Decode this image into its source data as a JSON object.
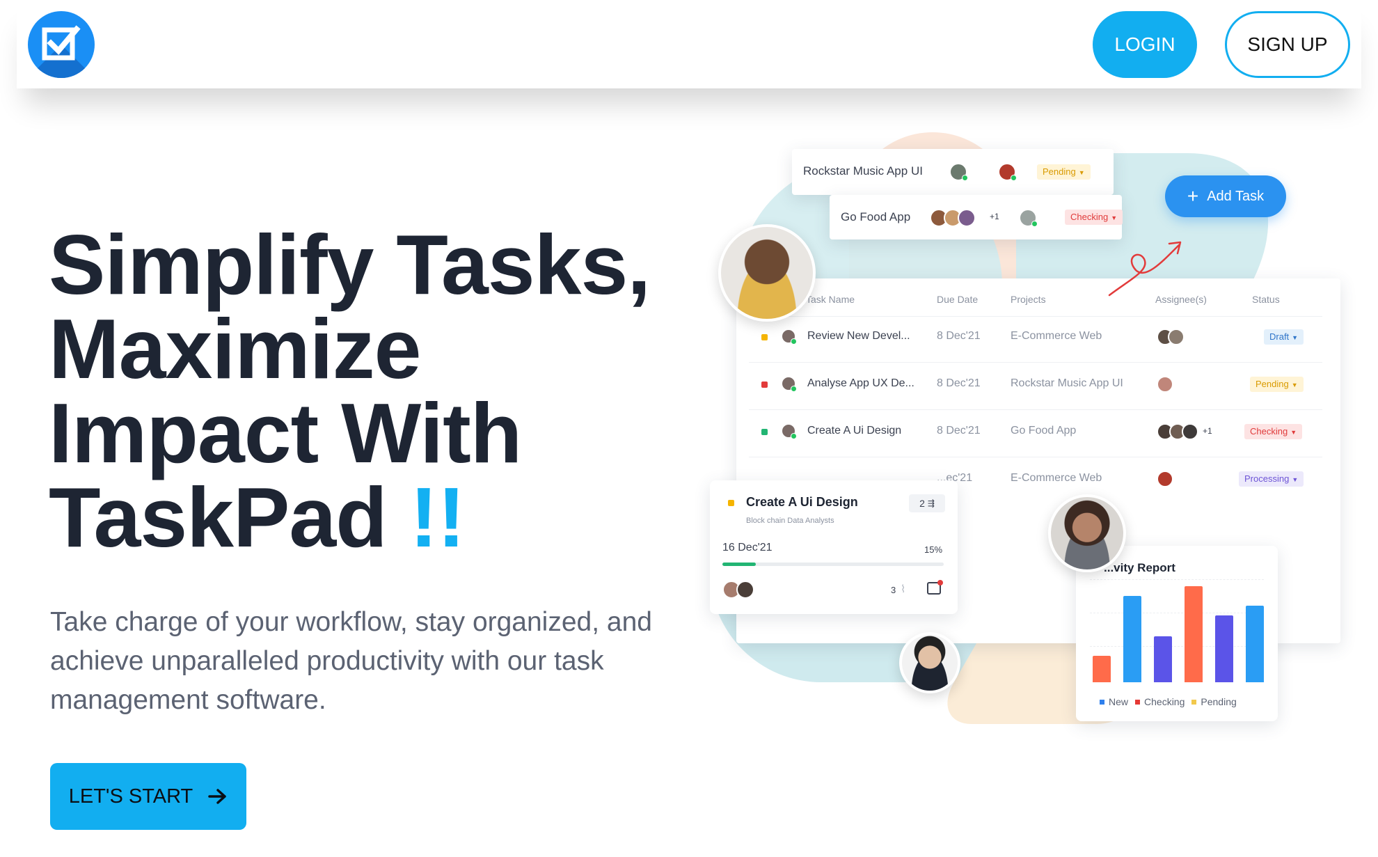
{
  "header": {
    "logo_icon": "checkbox-logo-icon",
    "login_label": "LOGIN",
    "signup_label": "SIGN UP"
  },
  "hero": {
    "title_lines": [
      "Simplify Tasks,",
      "Maximize",
      "Impact With",
      "TaskPad"
    ],
    "title_accent": "!!",
    "subtitle": "Take charge of your workflow, stay organized, and achieve unparalleled productivity with our task management software.",
    "cta_label": "LET'S START",
    "cta_icon": "arrow-right-icon"
  },
  "illustration": {
    "mini_tasks": [
      {
        "name": "Rockstar Music App UI",
        "status": "Pending"
      },
      {
        "name": "Go Food App",
        "extra": "+1",
        "status": "Checking"
      }
    ],
    "add_task_label": "Add Task",
    "table": {
      "headers": [
        "Task Name",
        "Due Date",
        "Projects",
        "Assignee(s)",
        "Status"
      ],
      "rows": [
        {
          "name": "Review New Devel...",
          "due": "8 Dec'21",
          "project": "E-Commerce Web",
          "status": "Draft",
          "extra": ""
        },
        {
          "name": "Analyse App UX De...",
          "due": "8 Dec'21",
          "project": "Rockstar Music App UI",
          "status": "Pending",
          "extra": ""
        },
        {
          "name": "Create A Ui Design",
          "due": "8 Dec'21",
          "project": "Go Food App",
          "status": "Checking",
          "extra": "+1"
        },
        {
          "name": "",
          "due": "...ec'21",
          "project": "E-Commerce Web",
          "status": "Processing",
          "extra": ""
        }
      ]
    },
    "task_card": {
      "title": "Create A Ui Design",
      "subtitle": "Block chain Data Analysts",
      "subtasks": "2",
      "date": "16 Dec'21",
      "progress_label": "15%",
      "progress": 0.15,
      "attachments": "3"
    },
    "report": {
      "title": "...vity Report",
      "legend": [
        "New",
        "Checking",
        "Pending"
      ],
      "colors": {
        "new": "#2f80ed",
        "checking": "#e53935",
        "pending": "#f2c94c"
      }
    }
  },
  "colors": {
    "accent": "#12aef0",
    "title": "#1e2533",
    "body": "#5b6272"
  }
}
